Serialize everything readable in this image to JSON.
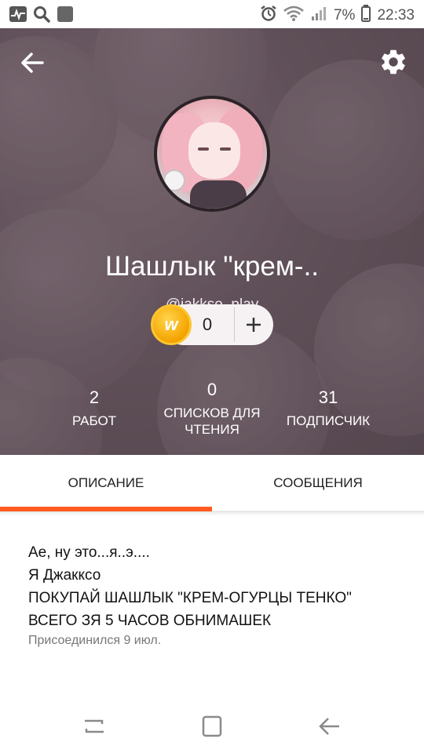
{
  "status_bar": {
    "battery_percent": "7%",
    "time": "22:33",
    "icons": [
      "activity-icon",
      "search-icon",
      "app-icon",
      "alarm-icon",
      "wifi-icon",
      "signal-icon",
      "battery-icon"
    ]
  },
  "header": {
    "back_icon": "arrow-left-icon",
    "settings_icon": "gear-icon",
    "display_name": "Шашлык \"крем-..",
    "username": "@jakkso_play",
    "coins": {
      "icon": "wattpad-coin-icon",
      "letter": "w",
      "count": "0",
      "add_label": "+"
    },
    "stats": [
      {
        "value": "2",
        "label": "РАБОТ"
      },
      {
        "value": "0",
        "label": "СПИСКОВ ДЛЯ ЧТЕНИЯ"
      },
      {
        "value": "31",
        "label": "ПОДПИСЧИК"
      }
    ]
  },
  "tabs": [
    {
      "label": "ОПИСАНИЕ",
      "active": true
    },
    {
      "label": "СООБЩЕНИЯ",
      "active": false
    }
  ],
  "colors": {
    "accent": "#ff5a1f",
    "coin": "#f4a300"
  },
  "description": {
    "lines": [
      "Ае, ну это...я..э....",
      "Я Джакксо",
      "ПОКУПАЙ ШАШЛЫК \"КРЕМ-ОГУРЦЫ ТЕНКО\"",
      "ВСЕГО ЗЯ 5 ЧАСОВ ОБНИМАШЕК"
    ],
    "joined": "Присоединился 9 июл."
  },
  "nav_bar": {
    "icons": [
      "recent-apps-icon",
      "home-icon",
      "back-icon"
    ]
  }
}
